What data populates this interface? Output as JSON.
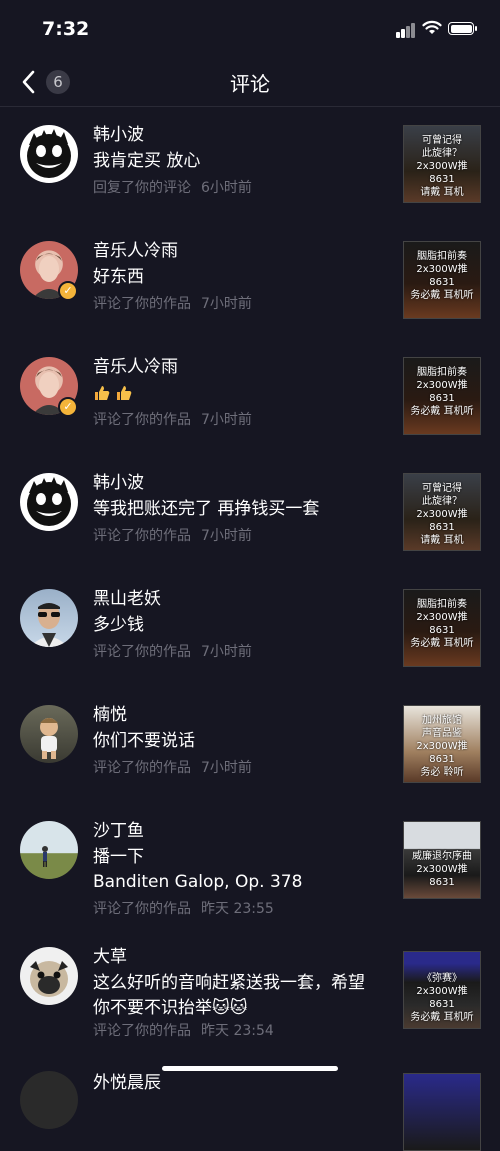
{
  "status_bar": {
    "time": "7:32"
  },
  "nav": {
    "title": "评论",
    "count": "6"
  },
  "items": [
    {
      "name": "韩小波",
      "comment": "我肯定买 放心",
      "action": "回复了你的评论",
      "time": "6小时前",
      "avatar": "monster",
      "thumb_text": "可曾记得\n此旋律？\n2x300W推8631\n请戴  耳机"
    },
    {
      "name": "音乐人冷雨",
      "comment": "好东西",
      "action": "评论了你的作品",
      "time": "7小时前",
      "avatar": "man-pink",
      "verified": true,
      "thumb_text": "胭脂扣前奏\n2x300W推8631\n务必戴  耳机听"
    },
    {
      "name": "音乐人冷雨",
      "comment": "👍👍",
      "action": "评论了你的作品",
      "time": "7小时前",
      "avatar": "man-pink",
      "verified": true,
      "thumb_text": "胭脂扣前奏\n2x300W推8631\n务必戴  耳机听"
    },
    {
      "name": "韩小波",
      "comment": "等我把账还完了 再挣钱买一套",
      "action": "评论了你的作品",
      "time": "7小时前",
      "avatar": "monster",
      "thumb_text": "可曾记得\n此旋律？\n2x300W推8631\n请戴  耳机"
    },
    {
      "name": "黑山老妖",
      "comment": "多少钱",
      "action": "评论了你的作品",
      "time": "7小时前",
      "avatar": "man-glasses",
      "thumb_text": "胭脂扣前奏\n2x300W推8631\n务必戴  耳机听"
    },
    {
      "name": "楠悦",
      "comment": "你们不要说话",
      "action": "评论了你的作品",
      "time": "7小时前",
      "avatar": "baby",
      "thumb_text": "加州旅馆\n声音品鉴\n2x300W推8631\n务必  聆听"
    },
    {
      "name": "沙丁鱼",
      "comment": "播一下",
      "comment2": "Banditen Galop, Op. 378",
      "action": "评论了你的作品",
      "time": "昨天 23:55",
      "avatar": "field",
      "thumb_text": "威廉退尔序曲\n2x300W推8631"
    },
    {
      "name": "大草",
      "comment": "这么好听的音响赶紧送我一套，希望",
      "comment2": "你不要不识抬举🐱🐱",
      "action": "评论了你的作品",
      "time": "昨天 23:54",
      "avatar": "pug",
      "thumb_text": "《弥赛》\n2x300W推8631\n务必戴  耳机听"
    },
    {
      "name": "外悦晨辰"
    }
  ]
}
